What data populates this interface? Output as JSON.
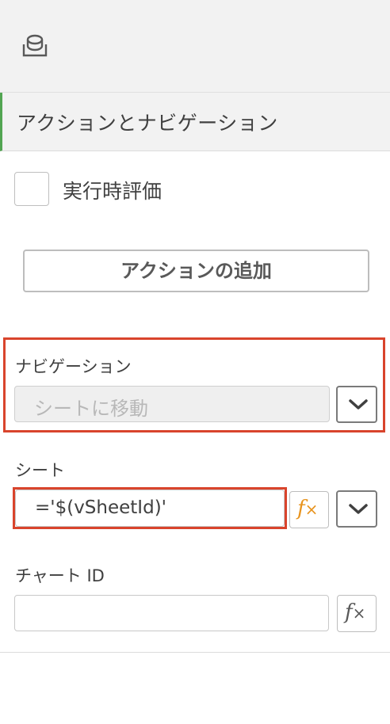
{
  "top_bar": {
    "icon": "database-icon"
  },
  "section": {
    "title": "アクションとナビゲーション"
  },
  "evaluate": {
    "checked": false,
    "label": "実行時評価"
  },
  "add_action": {
    "label": "アクションの追加"
  },
  "navigation": {
    "label": "ナビゲーション",
    "selected": "シートに移動",
    "dropdown_icon": "chevron-down-icon"
  },
  "sheet": {
    "label": "シート",
    "value": "='$(vSheetId)'",
    "fx_icon": "function-fx-icon",
    "dropdown_icon": "chevron-down-icon"
  },
  "chart_id": {
    "label": "チャート ID",
    "value": "",
    "fx_icon": "function-fx-icon"
  },
  "colors": {
    "accent_green": "#52a552",
    "highlight_red": "#d9442c",
    "fx_orange": "#e8941f"
  }
}
